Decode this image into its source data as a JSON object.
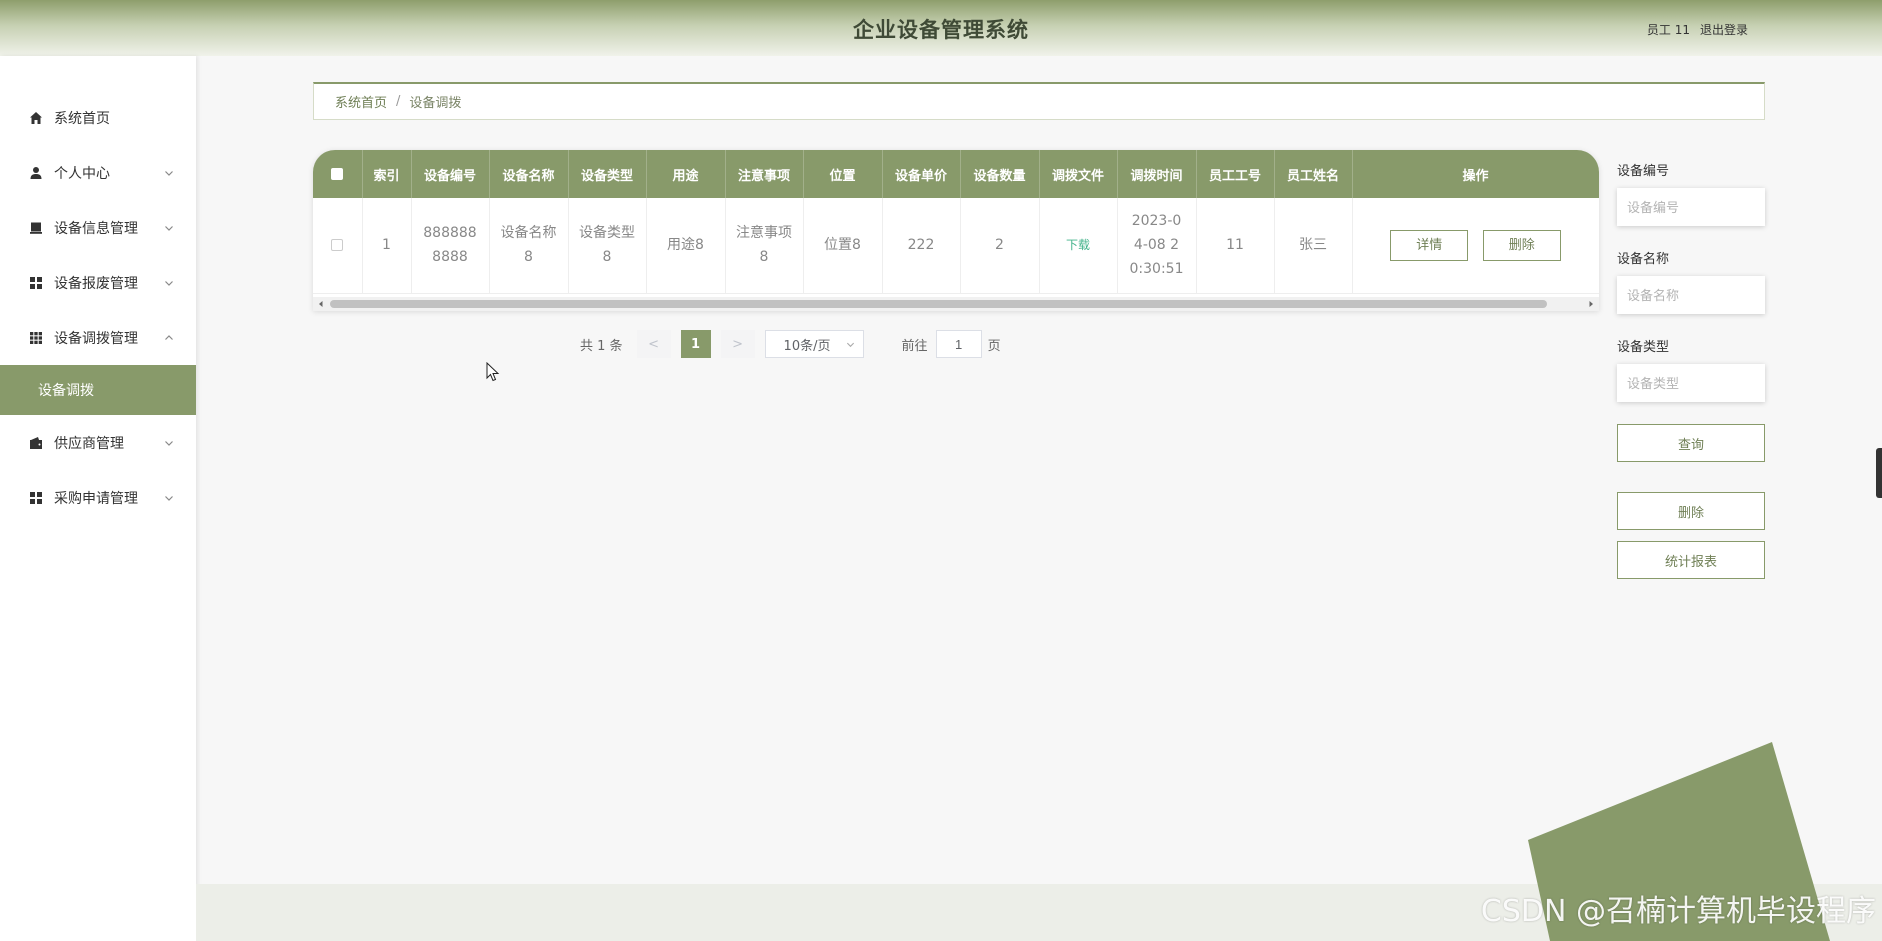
{
  "header": {
    "title": "企业设备管理系统",
    "user": "员工 11",
    "logout": "退出登录"
  },
  "sidebar": {
    "items": [
      {
        "label": "系统首页",
        "icon": "home-icon"
      },
      {
        "label": "个人中心",
        "icon": "user-icon"
      },
      {
        "label": "设备信息管理",
        "icon": "device-icon"
      },
      {
        "label": "设备报废管理",
        "icon": "grid-icon"
      },
      {
        "label": "设备调拨管理",
        "icon": "grid9-icon"
      },
      {
        "label": "供应商管理",
        "icon": "wallet-icon"
      },
      {
        "label": "采购申请管理",
        "icon": "grid-icon"
      }
    ],
    "active_sub": "设备调拨"
  },
  "breadcrumb": {
    "home": "系统首页",
    "separator": "/",
    "current": "设备调拨"
  },
  "table": {
    "headers": [
      "索引",
      "设备编号",
      "设备名称",
      "设备类型",
      "用途",
      "注意事项",
      "位置",
      "设备单价",
      "设备数量",
      "调拨文件",
      "调拨时间",
      "员工工号",
      "员工姓名",
      "操作"
    ],
    "rows": [
      {
        "index": "1",
        "number": "8888888888",
        "name": "设备名称8",
        "type": "设备类型8",
        "usage": "用途8",
        "notes": "注意事项8",
        "location": "位置8",
        "price": "222",
        "qty": "2",
        "file": "下载",
        "time": "2023-04-08 20:30:51",
        "emp_no": "11",
        "emp_name": "张三",
        "detail": "详情",
        "delete": "删除"
      }
    ]
  },
  "pagination": {
    "total": "共 1 条",
    "prev": "<",
    "current": "1",
    "next": ">",
    "page_size": "10条/页",
    "goto_label": "前往",
    "goto_value": "1",
    "page_unit": "页"
  },
  "search": {
    "number_label": "设备编号",
    "number_placeholder": "设备编号",
    "name_label": "设备名称",
    "name_placeholder": "设备名称",
    "type_label": "设备类型",
    "type_placeholder": "设备类型",
    "query": "查询",
    "delete": "删除",
    "report": "统计报表"
  },
  "watermark": "CSDN @召楠计算机毕设程序",
  "colors": {
    "accent": "#889a6a",
    "link": "#43b38b"
  }
}
